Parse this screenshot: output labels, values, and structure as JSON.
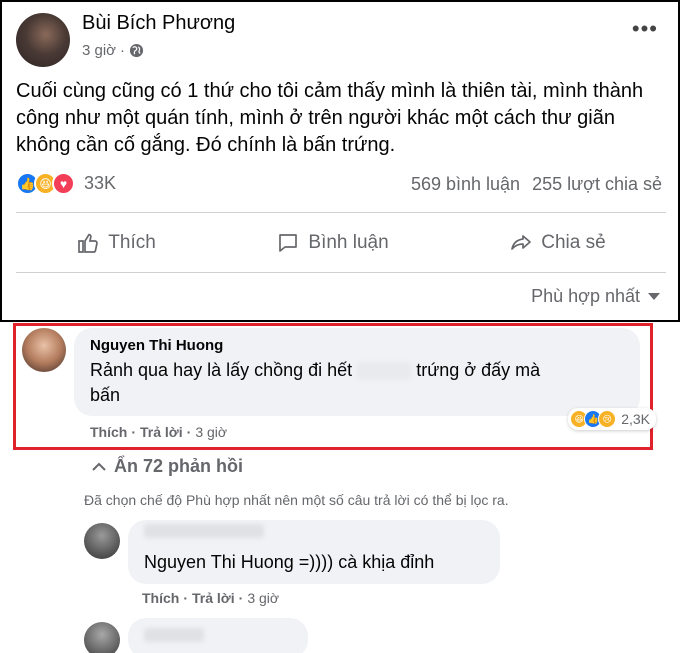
{
  "post": {
    "author": "Bùi Bích Phương",
    "time": "3 giờ",
    "text": "Cuối cùng cũng có 1 thứ cho tôi cảm thấy mình là thiên tài, mình thành công như một quán tính, mình ở trên người khác một cách thư giãn không cần cố gắng. Đó chính là bấn trứng.",
    "reaction_count": "33K",
    "comments_count": "569 bình luận",
    "shares_count": "255 lượt chia sẻ",
    "actions": {
      "like": "Thích",
      "comment": "Bình luận",
      "share": "Chia sẻ"
    },
    "sort_label": "Phù hợp nhất"
  },
  "comment1": {
    "name": "Nguyen Thi Huong",
    "text_part1": "Rảnh qua hay là lấy chồng đi hết",
    "text_part2": "trứng ở đấy mà",
    "text_part3": "bấn",
    "reaction_count": "2,3K",
    "like": "Thích",
    "reply": "Trả lời",
    "time": "3 giờ"
  },
  "replies": {
    "hide_label": "Ẩn 72 phản hồi",
    "filter_note": "Đã chọn chế độ Phù hợp nhất nên một số câu trả lời có thể bị lọc ra."
  },
  "reply1": {
    "text": "Nguyen Thi Huong =)))) cà khịa đỉnh",
    "like": "Thích",
    "reply": "Trả lời",
    "time": "3 giờ"
  },
  "colors": {
    "highlight": "#e0222a",
    "muted": "#65676b",
    "bubble": "#f0f2f5",
    "like_blue": "#1877f2"
  },
  "icons": [
    "more-icon",
    "globe-icon",
    "like-icon",
    "comment-icon",
    "share-icon",
    "caret-down-icon",
    "haha-reaction",
    "love-reaction",
    "sad-reaction",
    "chevron-up-icon"
  ]
}
